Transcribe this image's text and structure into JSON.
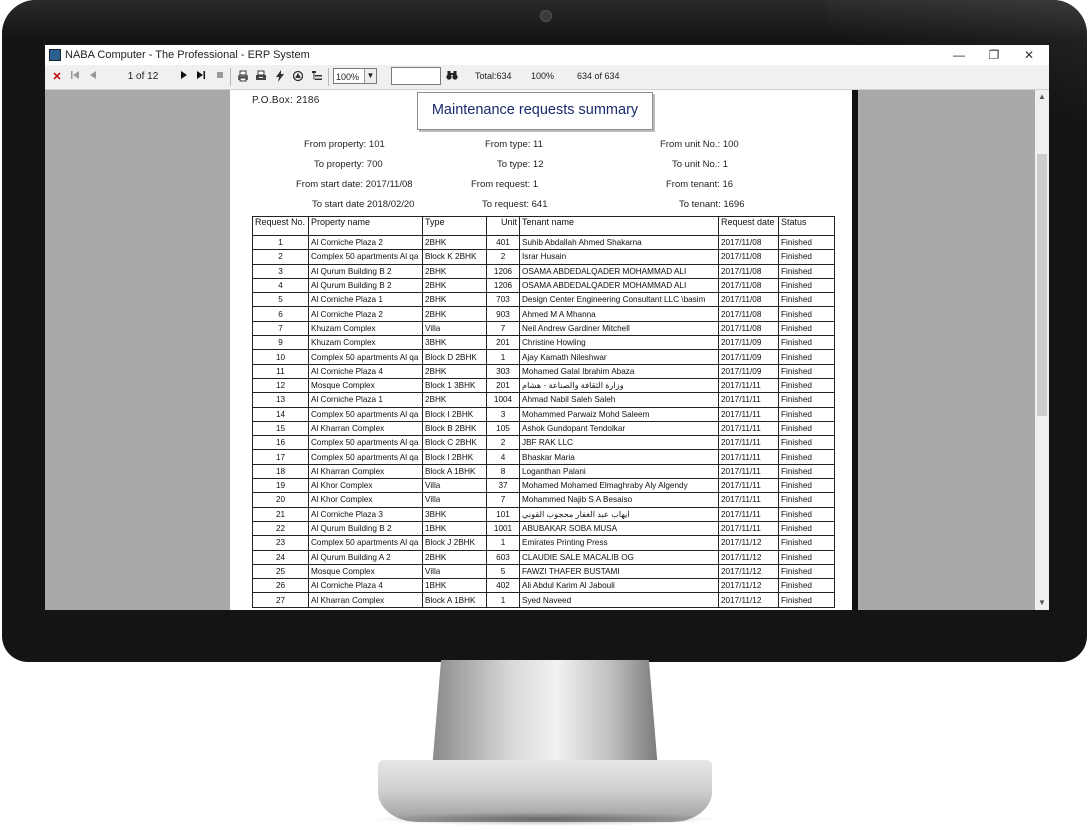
{
  "window": {
    "title": "NABA Computer - The Professional - ERP System",
    "minimize": "—",
    "maximize": "❐",
    "close": "✕"
  },
  "toolbar": {
    "close_icon": "✕",
    "page_indicator": "1 of 12",
    "zoom": "100%",
    "find_value": "",
    "total": "Total:634",
    "percent": "100%",
    "count": "634 of 634"
  },
  "report": {
    "pobox": "P.O.Box: 2186",
    "title": "Maintenance requests summary",
    "filters": {
      "from_property": "From property: 101",
      "to_property": "To property: 700",
      "from_start_date": "From start date: 2017/11/08",
      "to_start_date": "To start date 2018/02/20",
      "from_type": "From type: 11",
      "to_type": "To type: 12",
      "from_request": "From request: 1",
      "to_request": "To request: 641",
      "from_unit": "From unit No.: 100",
      "to_unit": "To unit No.: 1",
      "from_tenant": "From tenant: 16",
      "to_tenant": "To tenant: 1696"
    },
    "columns": [
      "Request No.",
      "Property name",
      "Type",
      "Unit",
      "Tenant name",
      "Request date",
      "Status"
    ],
    "rows": [
      [
        "1",
        "Al Corniche Plaza 2",
        "2BHK",
        "401",
        "Suhib Abdallah Ahmed Shakarna",
        "2017/11/08",
        "Finished"
      ],
      [
        "2",
        "Complex 50 apartments Al qa",
        "Block K 2BHK",
        "2",
        "Israr Husain",
        "2017/11/08",
        "Finished"
      ],
      [
        "3",
        "Al Qurum Building B 2",
        "2BHK",
        "1206",
        "OSAMA ABDEDALQADER MOHAMMAD ALI",
        "2017/11/08",
        "Finished"
      ],
      [
        "4",
        "Al Qurum Building B 2",
        "2BHK",
        "1206",
        "OSAMA ABDEDALQADER MOHAMMAD ALI",
        "2017/11/08",
        "Finished"
      ],
      [
        "5",
        "Al Corniche Plaza 1",
        "2BHK",
        "703",
        "Design Center Engineering Consultant LLC \\basim",
        "2017/11/08",
        "Finished"
      ],
      [
        "6",
        "Al Corniche Plaza 2",
        "2BHK",
        "903",
        "Ahmed M A Mhanna",
        "2017/11/08",
        "Finished"
      ],
      [
        "7",
        "Khuzam Complex",
        "Villa",
        "7",
        "Neil Andrew Gardiner Mitchell",
        "2017/11/08",
        "Finished"
      ],
      [
        "9",
        "Khuzam Complex",
        "3BHK",
        "201",
        "Christine Howling",
        "2017/11/09",
        "Finished"
      ],
      [
        "10",
        "Complex 50 apartments Al qa",
        "Block D 2BHK",
        "1",
        "Ajay Kamath Nileshwar",
        "2017/11/09",
        "Finished"
      ],
      [
        "11",
        "Al Corniche Plaza 4",
        "2BHK",
        "303",
        "Mohamed Galal Ibrahim Abaza",
        "2017/11/09",
        "Finished"
      ],
      [
        "12",
        "Mosque Complex",
        "Block 1 3BHK",
        "201",
        "وزارة الثقافة والصناعة - هشام",
        "2017/11/11",
        "Finished"
      ],
      [
        "13",
        "Al Corniche Plaza 1",
        "2BHK",
        "1004",
        "Ahmad Nabil Saleh Saleh",
        "2017/11/11",
        "Finished"
      ],
      [
        "14",
        "Complex 50 apartments Al qa",
        "Block I 2BHK",
        "3",
        "Mohammed Parwaiz Mohd Saleem",
        "2017/11/11",
        "Finished"
      ],
      [
        "15",
        "Al Kharran Complex",
        "Block B 2BHK",
        "105",
        "Ashok Gundopant Tendolkar",
        "2017/11/11",
        "Finished"
      ],
      [
        "16",
        "Complex 50 apartments Al qa",
        "Block C 2BHK",
        "2",
        "JBF RAK LLC",
        "2017/11/11",
        "Finished"
      ],
      [
        "17",
        "Complex 50 apartments Al qa",
        "Block I 2BHK",
        "4",
        "Bhaskar Maria",
        "2017/11/11",
        "Finished"
      ],
      [
        "18",
        "Al Kharran Complex",
        "Block A 1BHK",
        "8",
        "Loganthan Palani",
        "2017/11/11",
        "Finished"
      ],
      [
        "19",
        "Al Khor Complex",
        "Villa",
        "37",
        "Mohamed Mohamed Elmaghraby Aly Algendy",
        "2017/11/11",
        "Finished"
      ],
      [
        "20",
        "Al Khor Complex",
        "Villa",
        "7",
        "Mohammed Najib S A Besaiso",
        "2017/11/11",
        "Finished"
      ],
      [
        "21",
        "Al Corniche Plaza 3",
        "3BHK",
        "101",
        "ايهاب عبد الغفار محجوب القوني",
        "2017/11/11",
        "Finished"
      ],
      [
        "22",
        "Al Qurum Building B 2",
        "1BHK",
        "1001",
        "ABUBAKAR SOBA MUSA",
        "2017/11/11",
        "Finished"
      ],
      [
        "23",
        "Complex 50 apartments Al qa",
        "Block J 2BHK",
        "1",
        "Emirates Printing Press",
        "2017/11/12",
        "Finished"
      ],
      [
        "24",
        "Al Qurum Building A 2",
        "2BHK",
        "603",
        "CLAUDIE SALE MACALIB OG",
        "2017/11/12",
        "Finished"
      ],
      [
        "25",
        "Mosque Complex",
        "Villa",
        "5",
        "FAWZI THAFER BUSTAMI",
        "2017/11/12",
        "Finished"
      ],
      [
        "26",
        "Al Corniche Plaza 4",
        "1BHK",
        "402",
        "Ali Abdul Karim Al Jabouli",
        "2017/11/12",
        "Finished"
      ],
      [
        "27",
        "Al Kharran Complex",
        "Block A 1BHK",
        "1",
        "Syed Naveed",
        "2017/11/12",
        "Finished"
      ]
    ]
  },
  "icons": {
    "first_page": "first-page-icon",
    "prev_page": "prev-page-icon",
    "next_page": "next-page-icon",
    "last_page": "last-page-icon",
    "stop": "stop-icon",
    "print": "print-icon",
    "export": "export-icon",
    "refresh": "refresh-icon",
    "find": "binoculars-icon"
  },
  "colors": {
    "report_title": "#1a2a6c",
    "viewer_background": "#a9a9a9",
    "close_icon": "#c00000"
  }
}
